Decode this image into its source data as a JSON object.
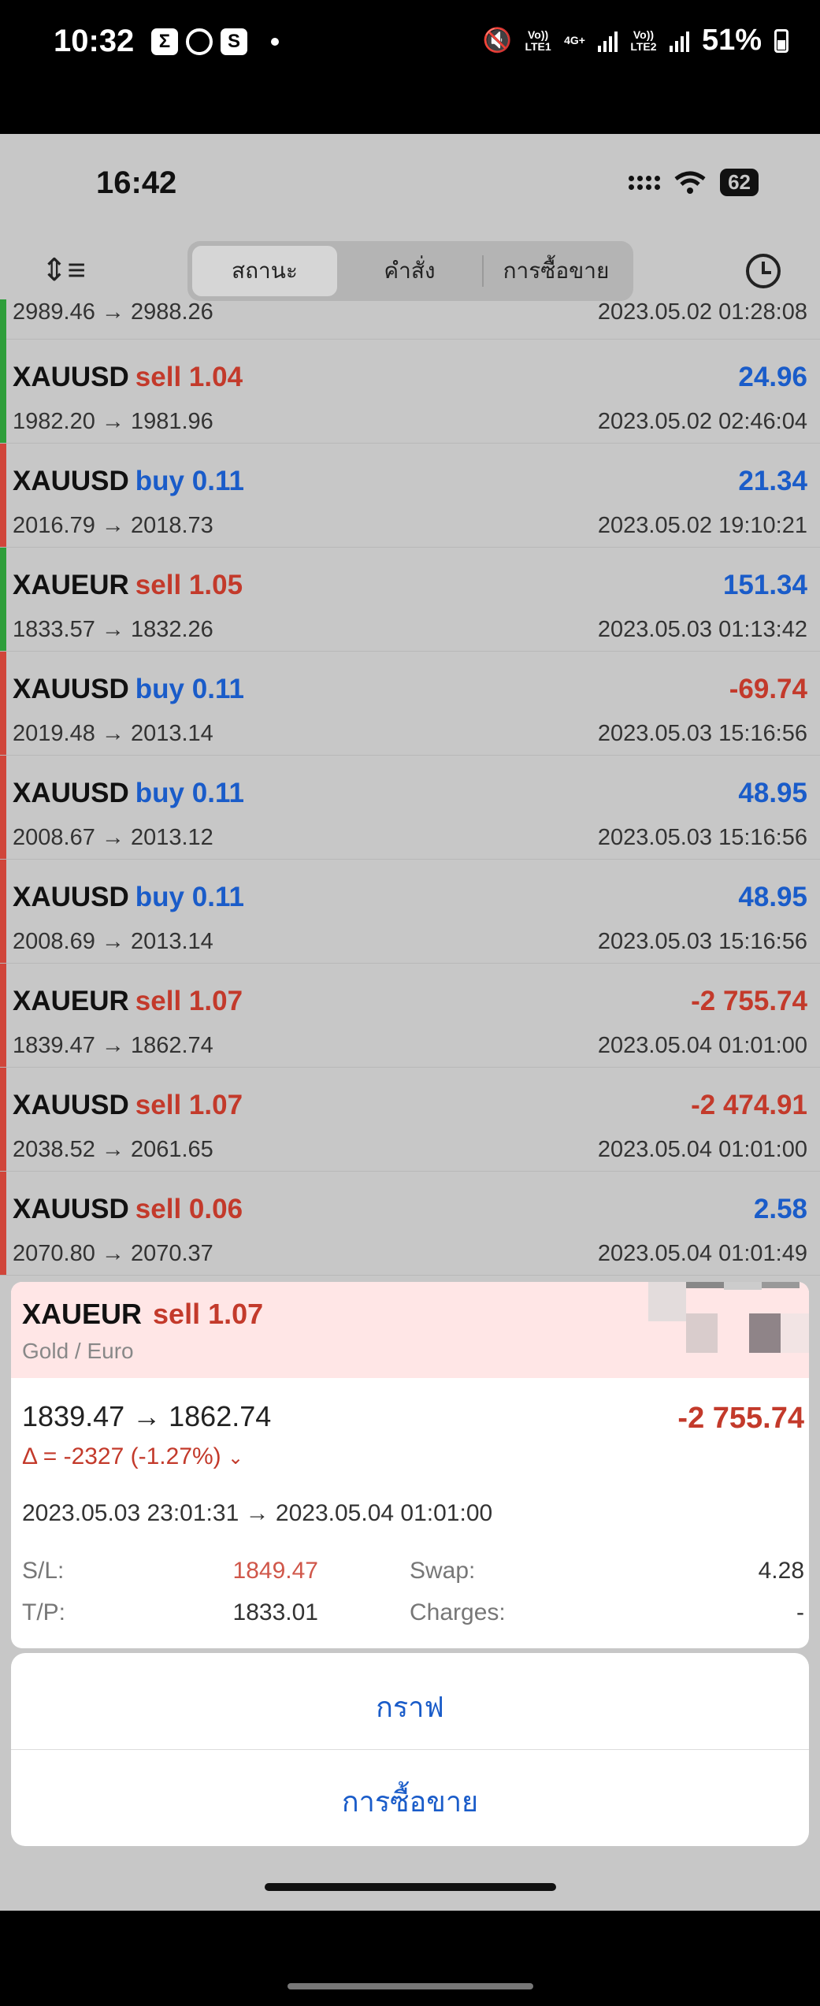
{
  "android_status": {
    "time": "10:32",
    "left_icons": [
      "Σ",
      "S"
    ],
    "net1": "Vo)) LTE1",
    "net2": "4G+",
    "net3": "Vo)) LTE2",
    "battery": "51%"
  },
  "ios_status": {
    "time": "16:42",
    "battery": "62"
  },
  "tabs": {
    "status": "สถานะ",
    "orders": "คำสั่ง",
    "trades": "การซื้อขาย"
  },
  "rows": [
    {
      "symbol": "",
      "action": "",
      "lot": "",
      "prices": "2989.46 → 2988.26",
      "pnl": "",
      "time": "2023.05.02 01:28:08",
      "color": "",
      "bar": "#2e9e3a",
      "partial": true
    },
    {
      "symbol": "XAUUSD",
      "action": "sell",
      "lot": "1.04",
      "prices": "1982.20 → 1981.96",
      "pnl": "24.96",
      "time": "2023.05.02 02:46:04",
      "color": "red",
      "pnlcolor": "blue",
      "bar": "#2e9e3a"
    },
    {
      "symbol": "XAUUSD",
      "action": "buy",
      "lot": "0.11",
      "prices": "2016.79 → 2018.73",
      "pnl": "21.34",
      "time": "2023.05.02 19:10:21",
      "color": "blue",
      "pnlcolor": "blue",
      "bar": "#d0453a"
    },
    {
      "symbol": "XAUEUR",
      "action": "sell",
      "lot": "1.05",
      "prices": "1833.57 → 1832.26",
      "pnl": "151.34",
      "time": "2023.05.03 01:13:42",
      "color": "red",
      "pnlcolor": "blue",
      "bar": "#2e9e3a"
    },
    {
      "symbol": "XAUUSD",
      "action": "buy",
      "lot": "0.11",
      "prices": "2019.48 → 2013.14",
      "pnl": "-69.74",
      "time": "2023.05.03 15:16:56",
      "color": "blue",
      "pnlcolor": "red",
      "bar": "#d0453a"
    },
    {
      "symbol": "XAUUSD",
      "action": "buy",
      "lot": "0.11",
      "prices": "2008.67 → 2013.12",
      "pnl": "48.95",
      "time": "2023.05.03 15:16:56",
      "color": "blue",
      "pnlcolor": "blue",
      "bar": "#d0453a"
    },
    {
      "symbol": "XAUUSD",
      "action": "buy",
      "lot": "0.11",
      "prices": "2008.69 → 2013.14",
      "pnl": "48.95",
      "time": "2023.05.03 15:16:56",
      "color": "blue",
      "pnlcolor": "blue",
      "bar": "#d0453a"
    },
    {
      "symbol": "XAUEUR",
      "action": "sell",
      "lot": "1.07",
      "prices": "1839.47 → 1862.74",
      "pnl": "-2 755.74",
      "time": "2023.05.04 01:01:00",
      "color": "red",
      "pnlcolor": "red",
      "bar": "#d0453a"
    },
    {
      "symbol": "XAUUSD",
      "action": "sell",
      "lot": "1.07",
      "prices": "2038.52 → 2061.65",
      "pnl": "-2 474.91",
      "time": "2023.05.04 01:01:00",
      "color": "red",
      "pnlcolor": "red",
      "bar": "#d0453a"
    },
    {
      "symbol": "XAUUSD",
      "action": "sell",
      "lot": "0.06",
      "prices": "2070.80 → 2070.37",
      "pnl": "2.58",
      "time": "2023.05.04 01:01:49",
      "color": "red",
      "pnlcolor": "blue",
      "bar": "#d0453a"
    }
  ],
  "detail": {
    "symbol": "XAUEUR",
    "action": "sell 1.07",
    "subtitle": "Gold / Euro",
    "prices": "1839.47 → 1862.74",
    "pnl": "-2 755.74",
    "delta": "Δ = -2327 (-1.27%)",
    "times": "2023.05.03 23:01:31 → 2023.05.04 01:01:00",
    "sl_label": "S/L:",
    "sl_value": "1849.47",
    "tp_label": "T/P:",
    "tp_value": "1833.01",
    "swap_label": "Swap:",
    "swap_value": "4.28",
    "charges_label": "Charges:",
    "charges_value": "-"
  },
  "sheet": {
    "chart": "กราฟ",
    "trade": "การซื้อขาย"
  }
}
